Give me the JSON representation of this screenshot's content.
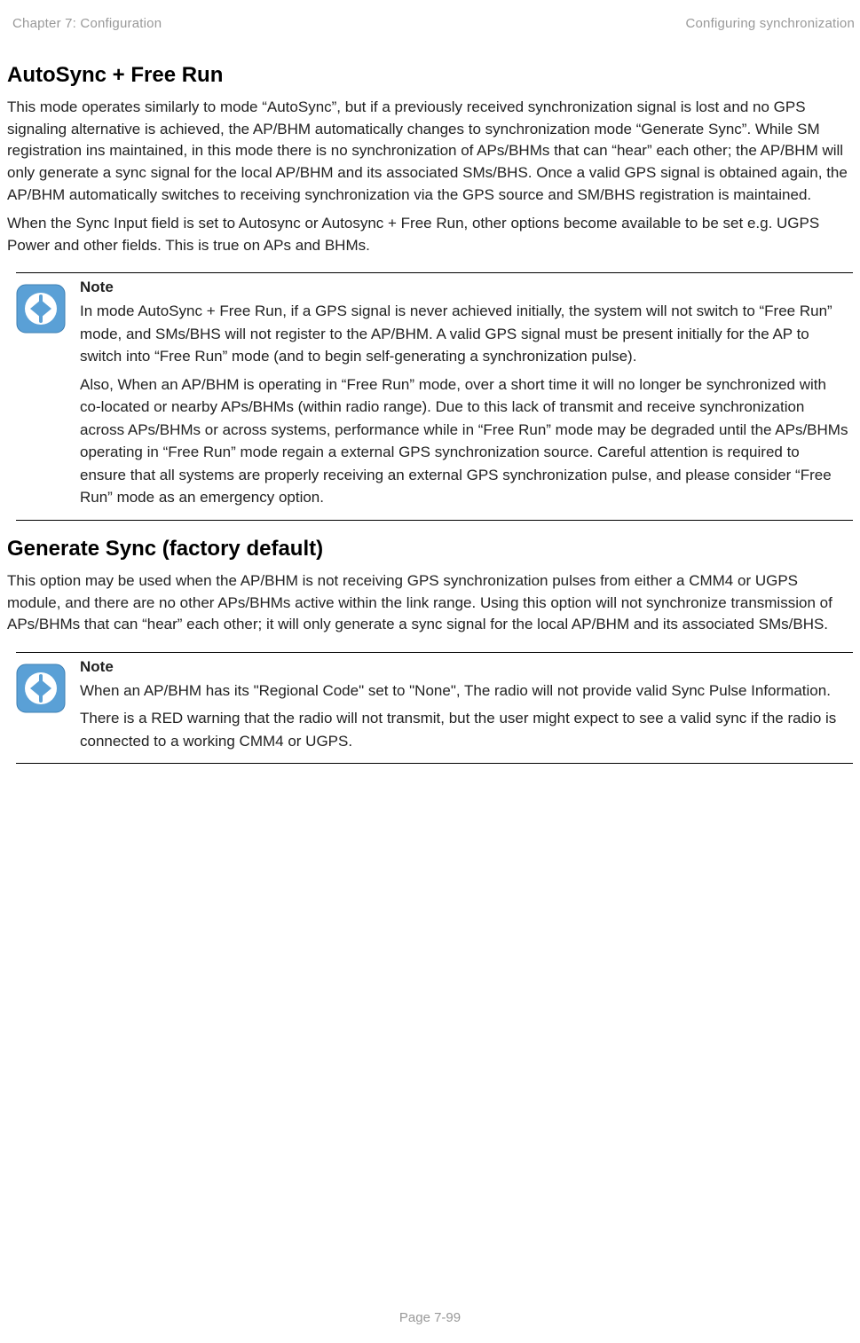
{
  "header": {
    "left": "Chapter 7:  Configuration",
    "right": "Configuring synchronization"
  },
  "sections": {
    "autosync": {
      "title": "AutoSync + Free Run",
      "p1": "This mode operates similarly to mode “AutoSync”, but if a previously received synchronization signal is lost and no GPS signaling alternative is achieved, the AP/BHM automatically changes to synchronization mode “Generate Sync”. While SM registration ins maintained, in this mode there is no synchronization of APs/BHMs that can “hear” each other; the AP/BHM will only generate a sync signal for the local AP/BHM and its associated SMs/BHS. Once a valid GPS signal is obtained again, the AP/BHM automatically switches to receiving synchronization via the GPS source and SM/BHS registration is maintained.",
      "p2": "When the Sync Input field is set to Autosync or Autosync + Free Run, other options become available to be set e.g. UGPS Power and other fields. This is true on APs and BHMs."
    },
    "note1": {
      "title": "Note",
      "p1": "In mode AutoSync + Free Run, if a GPS signal is never achieved initially, the system will not switch to “Free Run” mode, and SMs/BHS will not register to the AP/BHM. A valid GPS signal must be present initially for the AP to switch into “Free Run” mode (and to begin self-generating a synchronization pulse).",
      "p2": "Also, When an AP/BHM is operating in “Free Run” mode, over a short time it will no longer be synchronized with co-located or nearby APs/BHMs (within radio range). Due to this lack of transmit and receive synchronization across APs/BHMs or across systems, performance while in “Free Run” mode may be degraded until the APs/BHMs operating in “Free Run” mode regain a external GPS synchronization source. Careful attention is required to ensure that all systems are properly receiving an external GPS synchronization pulse, and please consider “Free Run” mode as an emergency option."
    },
    "generate": {
      "title": "Generate Sync (factory default)",
      "p1": "This option may be used when the AP/BHM is not receiving GPS synchronization pulses from either a CMM4 or UGPS module, and there are no other APs/BHMs active within the link range. Using this option will not synchronize transmission of APs/BHMs that can “hear” each other; it will only generate a sync signal for the local AP/BHM and its associated SMs/BHS."
    },
    "note2": {
      "title": "Note",
      "p1": "When an AP/BHM has its \"Regional Code\" set to \"None\", The radio will not provide valid Sync Pulse Information.",
      "p2": "There is a RED warning that the radio will not transmit, but the user might expect to see a valid sync if the radio is connected to a working CMM4 or UGPS."
    }
  },
  "footer": "Page 7-99"
}
